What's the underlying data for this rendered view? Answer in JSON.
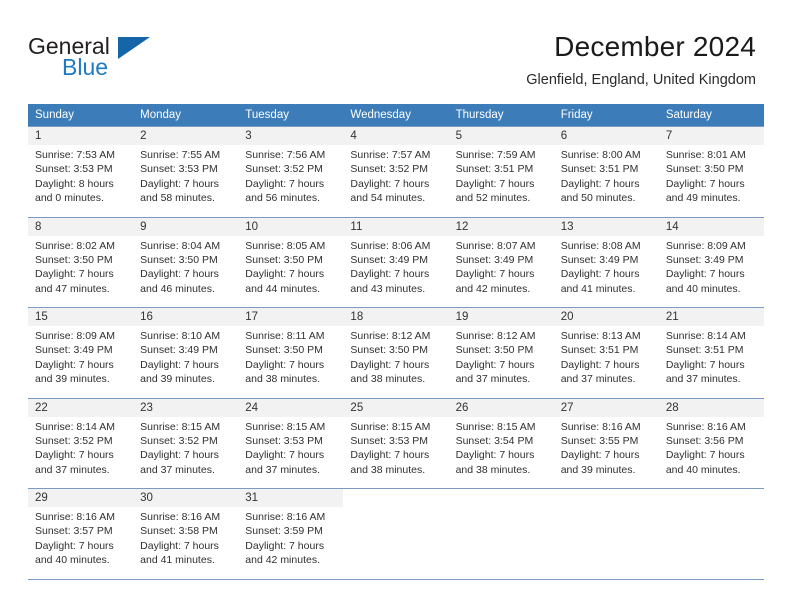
{
  "brand": {
    "name_part1": "General",
    "name_part2": "Blue",
    "triangle_color": "#1565a8",
    "blue_color": "#1f7bc1"
  },
  "header": {
    "title": "December 2024",
    "subtitle": "Glenfield, England, United Kingdom"
  },
  "theme": {
    "header_bg": "#3b7cb9",
    "daynum_bg": "#f2f2f2",
    "rule_color": "#7b9cc0"
  },
  "weekday_headers": [
    "Sunday",
    "Monday",
    "Tuesday",
    "Wednesday",
    "Thursday",
    "Friday",
    "Saturday"
  ],
  "weeks": [
    [
      {
        "day": "1",
        "sunrise": "Sunrise: 7:53 AM",
        "sunset": "Sunset: 3:53 PM",
        "daylight_1": "Daylight: 8 hours",
        "daylight_2": "and 0 minutes."
      },
      {
        "day": "2",
        "sunrise": "Sunrise: 7:55 AM",
        "sunset": "Sunset: 3:53 PM",
        "daylight_1": "Daylight: 7 hours",
        "daylight_2": "and 58 minutes."
      },
      {
        "day": "3",
        "sunrise": "Sunrise: 7:56 AM",
        "sunset": "Sunset: 3:52 PM",
        "daylight_1": "Daylight: 7 hours",
        "daylight_2": "and 56 minutes."
      },
      {
        "day": "4",
        "sunrise": "Sunrise: 7:57 AM",
        "sunset": "Sunset: 3:52 PM",
        "daylight_1": "Daylight: 7 hours",
        "daylight_2": "and 54 minutes."
      },
      {
        "day": "5",
        "sunrise": "Sunrise: 7:59 AM",
        "sunset": "Sunset: 3:51 PM",
        "daylight_1": "Daylight: 7 hours",
        "daylight_2": "and 52 minutes."
      },
      {
        "day": "6",
        "sunrise": "Sunrise: 8:00 AM",
        "sunset": "Sunset: 3:51 PM",
        "daylight_1": "Daylight: 7 hours",
        "daylight_2": "and 50 minutes."
      },
      {
        "day": "7",
        "sunrise": "Sunrise: 8:01 AM",
        "sunset": "Sunset: 3:50 PM",
        "daylight_1": "Daylight: 7 hours",
        "daylight_2": "and 49 minutes."
      }
    ],
    [
      {
        "day": "8",
        "sunrise": "Sunrise: 8:02 AM",
        "sunset": "Sunset: 3:50 PM",
        "daylight_1": "Daylight: 7 hours",
        "daylight_2": "and 47 minutes."
      },
      {
        "day": "9",
        "sunrise": "Sunrise: 8:04 AM",
        "sunset": "Sunset: 3:50 PM",
        "daylight_1": "Daylight: 7 hours",
        "daylight_2": "and 46 minutes."
      },
      {
        "day": "10",
        "sunrise": "Sunrise: 8:05 AM",
        "sunset": "Sunset: 3:50 PM",
        "daylight_1": "Daylight: 7 hours",
        "daylight_2": "and 44 minutes."
      },
      {
        "day": "11",
        "sunrise": "Sunrise: 8:06 AM",
        "sunset": "Sunset: 3:49 PM",
        "daylight_1": "Daylight: 7 hours",
        "daylight_2": "and 43 minutes."
      },
      {
        "day": "12",
        "sunrise": "Sunrise: 8:07 AM",
        "sunset": "Sunset: 3:49 PM",
        "daylight_1": "Daylight: 7 hours",
        "daylight_2": "and 42 minutes."
      },
      {
        "day": "13",
        "sunrise": "Sunrise: 8:08 AM",
        "sunset": "Sunset: 3:49 PM",
        "daylight_1": "Daylight: 7 hours",
        "daylight_2": "and 41 minutes."
      },
      {
        "day": "14",
        "sunrise": "Sunrise: 8:09 AM",
        "sunset": "Sunset: 3:49 PM",
        "daylight_1": "Daylight: 7 hours",
        "daylight_2": "and 40 minutes."
      }
    ],
    [
      {
        "day": "15",
        "sunrise": "Sunrise: 8:09 AM",
        "sunset": "Sunset: 3:49 PM",
        "daylight_1": "Daylight: 7 hours",
        "daylight_2": "and 39 minutes."
      },
      {
        "day": "16",
        "sunrise": "Sunrise: 8:10 AM",
        "sunset": "Sunset: 3:49 PM",
        "daylight_1": "Daylight: 7 hours",
        "daylight_2": "and 39 minutes."
      },
      {
        "day": "17",
        "sunrise": "Sunrise: 8:11 AM",
        "sunset": "Sunset: 3:50 PM",
        "daylight_1": "Daylight: 7 hours",
        "daylight_2": "and 38 minutes."
      },
      {
        "day": "18",
        "sunrise": "Sunrise: 8:12 AM",
        "sunset": "Sunset: 3:50 PM",
        "daylight_1": "Daylight: 7 hours",
        "daylight_2": "and 38 minutes."
      },
      {
        "day": "19",
        "sunrise": "Sunrise: 8:12 AM",
        "sunset": "Sunset: 3:50 PM",
        "daylight_1": "Daylight: 7 hours",
        "daylight_2": "and 37 minutes."
      },
      {
        "day": "20",
        "sunrise": "Sunrise: 8:13 AM",
        "sunset": "Sunset: 3:51 PM",
        "daylight_1": "Daylight: 7 hours",
        "daylight_2": "and 37 minutes."
      },
      {
        "day": "21",
        "sunrise": "Sunrise: 8:14 AM",
        "sunset": "Sunset: 3:51 PM",
        "daylight_1": "Daylight: 7 hours",
        "daylight_2": "and 37 minutes."
      }
    ],
    [
      {
        "day": "22",
        "sunrise": "Sunrise: 8:14 AM",
        "sunset": "Sunset: 3:52 PM",
        "daylight_1": "Daylight: 7 hours",
        "daylight_2": "and 37 minutes."
      },
      {
        "day": "23",
        "sunrise": "Sunrise: 8:15 AM",
        "sunset": "Sunset: 3:52 PM",
        "daylight_1": "Daylight: 7 hours",
        "daylight_2": "and 37 minutes."
      },
      {
        "day": "24",
        "sunrise": "Sunrise: 8:15 AM",
        "sunset": "Sunset: 3:53 PM",
        "daylight_1": "Daylight: 7 hours",
        "daylight_2": "and 37 minutes."
      },
      {
        "day": "25",
        "sunrise": "Sunrise: 8:15 AM",
        "sunset": "Sunset: 3:53 PM",
        "daylight_1": "Daylight: 7 hours",
        "daylight_2": "and 38 minutes."
      },
      {
        "day": "26",
        "sunrise": "Sunrise: 8:15 AM",
        "sunset": "Sunset: 3:54 PM",
        "daylight_1": "Daylight: 7 hours",
        "daylight_2": "and 38 minutes."
      },
      {
        "day": "27",
        "sunrise": "Sunrise: 8:16 AM",
        "sunset": "Sunset: 3:55 PM",
        "daylight_1": "Daylight: 7 hours",
        "daylight_2": "and 39 minutes."
      },
      {
        "day": "28",
        "sunrise": "Sunrise: 8:16 AM",
        "sunset": "Sunset: 3:56 PM",
        "daylight_1": "Daylight: 7 hours",
        "daylight_2": "and 40 minutes."
      }
    ],
    [
      {
        "day": "29",
        "sunrise": "Sunrise: 8:16 AM",
        "sunset": "Sunset: 3:57 PM",
        "daylight_1": "Daylight: 7 hours",
        "daylight_2": "and 40 minutes."
      },
      {
        "day": "30",
        "sunrise": "Sunrise: 8:16 AM",
        "sunset": "Sunset: 3:58 PM",
        "daylight_1": "Daylight: 7 hours",
        "daylight_2": "and 41 minutes."
      },
      {
        "day": "31",
        "sunrise": "Sunrise: 8:16 AM",
        "sunset": "Sunset: 3:59 PM",
        "daylight_1": "Daylight: 7 hours",
        "daylight_2": "and 42 minutes."
      },
      {
        "day": "",
        "sunrise": "",
        "sunset": "",
        "daylight_1": "",
        "daylight_2": ""
      },
      {
        "day": "",
        "sunrise": "",
        "sunset": "",
        "daylight_1": "",
        "daylight_2": ""
      },
      {
        "day": "",
        "sunrise": "",
        "sunset": "",
        "daylight_1": "",
        "daylight_2": ""
      },
      {
        "day": "",
        "sunrise": "",
        "sunset": "",
        "daylight_1": "",
        "daylight_2": ""
      }
    ]
  ]
}
